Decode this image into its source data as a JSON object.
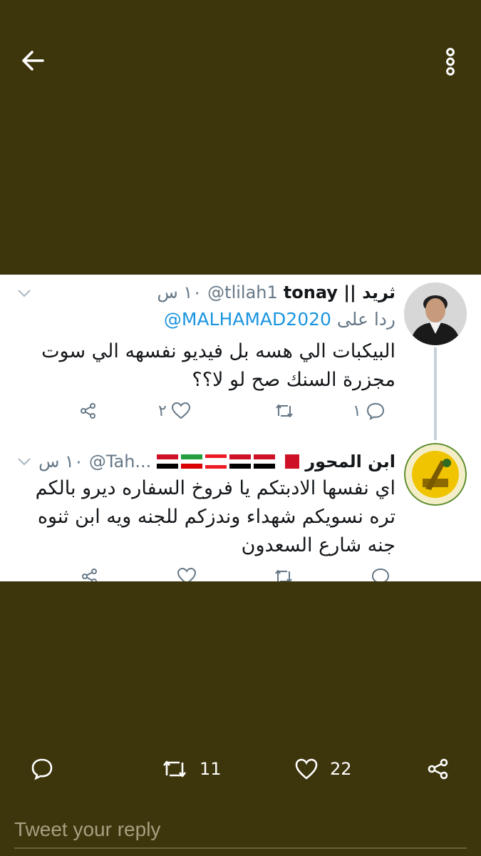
{
  "app": {
    "background_color": "#3d350c",
    "back_icon": "arrow-left-icon",
    "more_icon": "more-vertical-icon"
  },
  "embedded_tweets": [
    {
      "name": "ثريد || tonay",
      "handle": "@tlilah1",
      "time": "١٠ س",
      "reply_prefix": "ردا على",
      "reply_to": "@MALHAMAD2020",
      "text": "البيكبات الي هسه بل فيديو نفسهه الي سوت مجزرة السنك صح لو لا؟؟",
      "reply_count": "١",
      "retweet_count": "",
      "like_count": "٢"
    },
    {
      "name": "ابن المحور",
      "handle": "@Tah...",
      "time": "١٠ س",
      "flags": [
        "iraq",
        "iran",
        "lebanon",
        "syria",
        "yemen",
        "bahrain"
      ],
      "text": "اي نفسها الادبتكم يا فروخ السفاره ديرو بالكم تره نسويكم شهداء وندزكم للجنه ويه ابن ثنوه جنه شارع السعدون"
    }
  ],
  "actions": {
    "reply_icon": "reply-icon",
    "retweet_icon": "retweet-icon",
    "retweet_count": "11",
    "like_icon": "heart-icon",
    "like_count": "22",
    "share_icon": "share-icon"
  },
  "reply_box": {
    "placeholder": "Tweet your reply"
  }
}
